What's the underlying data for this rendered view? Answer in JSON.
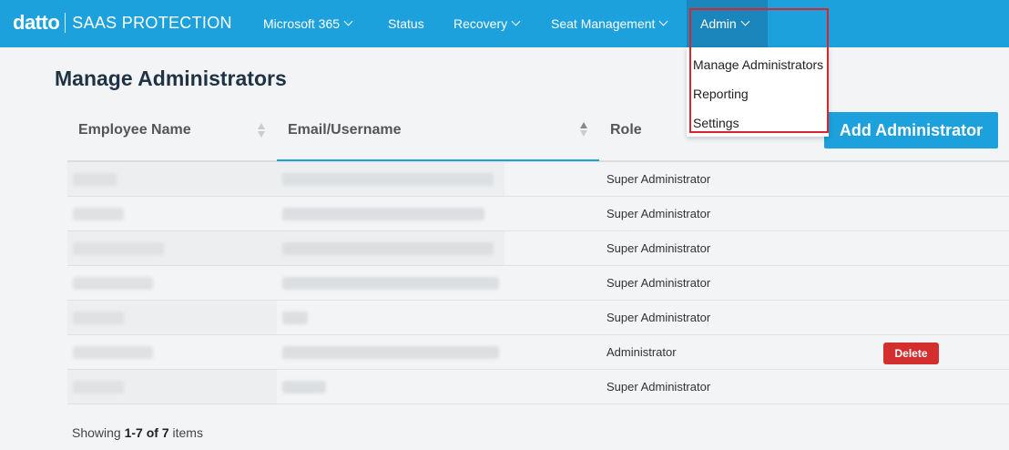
{
  "brand": {
    "logo": "datto",
    "product": "SAAS PROTECTION"
  },
  "nav": {
    "items": [
      {
        "label": "Microsoft 365",
        "has_dropdown": true
      },
      {
        "label": "Status",
        "has_dropdown": false
      },
      {
        "label": "Recovery",
        "has_dropdown": true
      },
      {
        "label": "Seat Management",
        "has_dropdown": true
      },
      {
        "label": "Admin",
        "has_dropdown": true,
        "active": true
      }
    ]
  },
  "admin_menu": {
    "items": [
      "Manage Administrators",
      "Reporting",
      "Settings"
    ]
  },
  "page": {
    "title": "Manage Administrators"
  },
  "toolbar": {
    "add_label": "Add Administrator"
  },
  "table": {
    "columns": [
      "Employee Name",
      "Email/Username",
      "Role"
    ],
    "sorted_column": "Email/Username",
    "rows": [
      {
        "role": "Super Administrator",
        "action": ""
      },
      {
        "role": "Super Administrator",
        "action": ""
      },
      {
        "role": "Super Administrator",
        "action": ""
      },
      {
        "role": "Super Administrator",
        "action": ""
      },
      {
        "role": "Super Administrator",
        "action": ""
      },
      {
        "role": "Administrator",
        "action": "Delete"
      },
      {
        "role": "Super Administrator",
        "action": ""
      }
    ]
  },
  "pagination": {
    "prefix": "Showing ",
    "range": "1-7",
    "of": " of ",
    "total": "7",
    "suffix": " items"
  },
  "colors": {
    "brand_blue": "#1da1dc",
    "active_nav": "#1a86bb",
    "delete_red": "#d32f2f",
    "highlight_red": "#d9262c",
    "title": "#1f3345"
  }
}
